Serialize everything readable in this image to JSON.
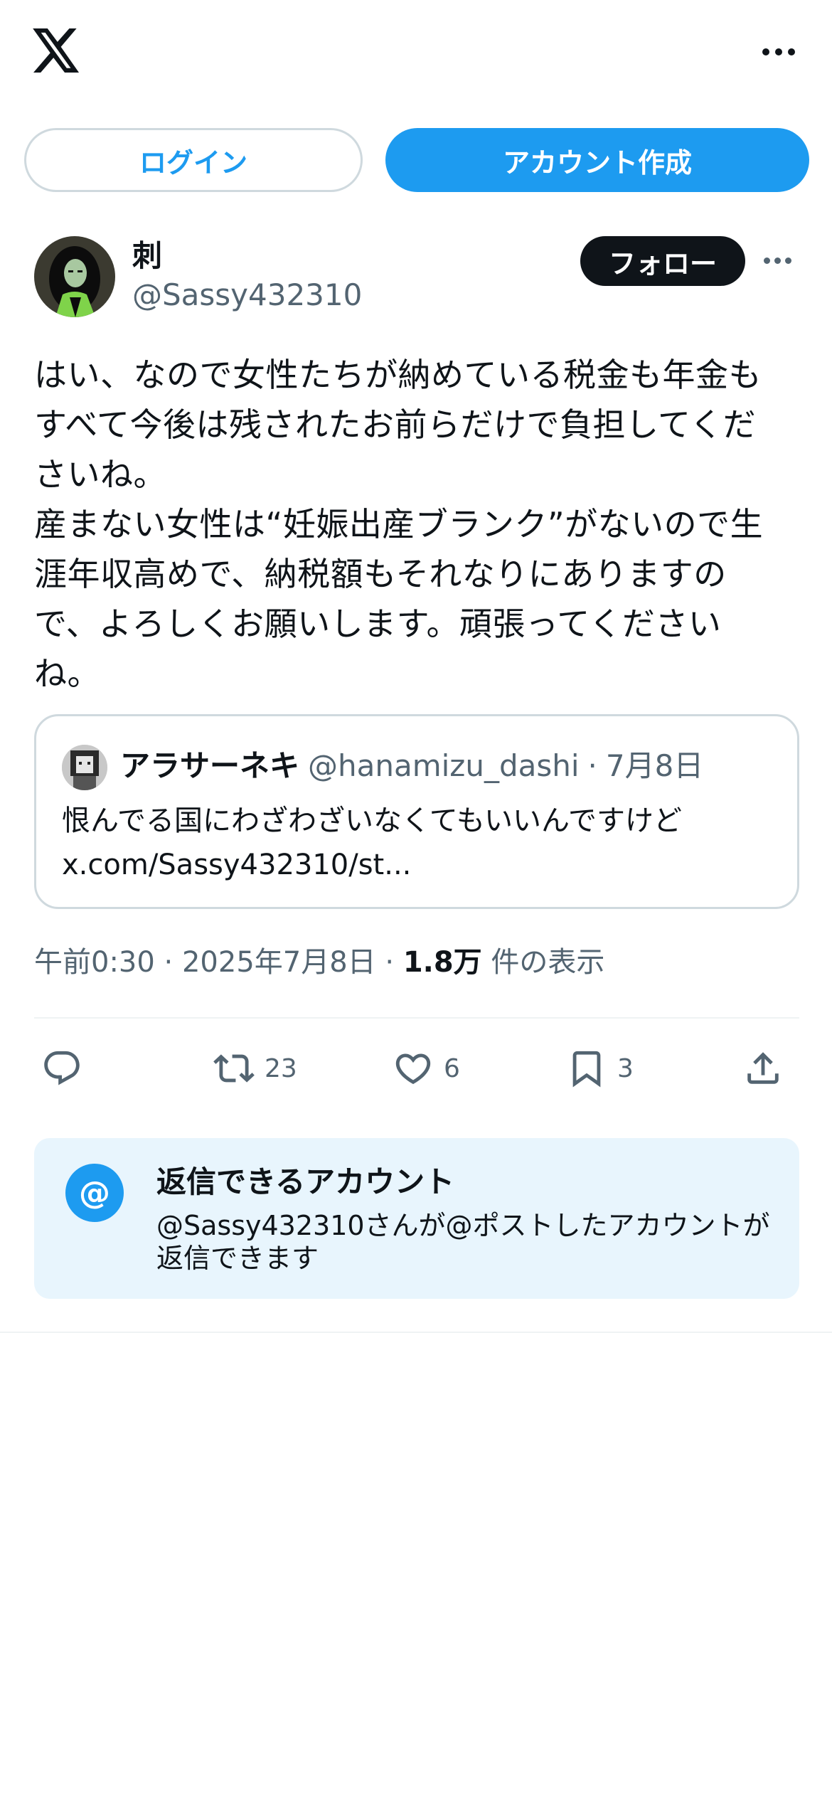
{
  "header": {
    "logo": "x-logo-icon",
    "more": "more-horizontal-icon"
  },
  "auth": {
    "login_label": "ログイン",
    "signup_label": "アカウント作成"
  },
  "post": {
    "display_name": "刺",
    "handle": "@Sassy432310",
    "follow_label": "フォロー",
    "text": "はい、なので女性たちが納めている税金も年金も\nすべて今後は残されたお前らだけで負担してくだ\nさいね。\n産まない女性は“妊娠出産ブランク”がないので生\n涯年収高めで、納税額もそれなりにありますの\nで、よろしくお願いします。頑張ってください\nね。",
    "quote": {
      "display_name": "アラサーネキ",
      "handle": "@hanamizu_dashi",
      "separator": "·",
      "date": "7月8日",
      "text_line1": "恨んでる国にわざわざいなくてもいいんですけど",
      "text_line2": "x.com/Sassy432310/st..."
    },
    "timestamp": "午前0:30 · 2025年7月8日 · ",
    "views_count": "1.8万",
    "views_label": " 件の表示"
  },
  "actions": {
    "reply": {
      "icon": "reply-icon",
      "count": ""
    },
    "repost": {
      "icon": "repost-icon",
      "count": "23"
    },
    "like": {
      "icon": "heart-icon",
      "count": "6"
    },
    "bookmark": {
      "icon": "bookmark-icon",
      "count": "3"
    },
    "share": {
      "icon": "share-icon"
    }
  },
  "reply_restriction": {
    "icon_text": "@",
    "title": "返信できるアカウント",
    "description": "@Sassy432310さんが@ポストしたアカウントが返信できます"
  },
  "colors": {
    "accent": "#1d9bf0",
    "text_primary": "#0f1419",
    "text_secondary": "#536471",
    "border": "#cfd9de",
    "reply_box_bg": "#e8f5fd"
  }
}
